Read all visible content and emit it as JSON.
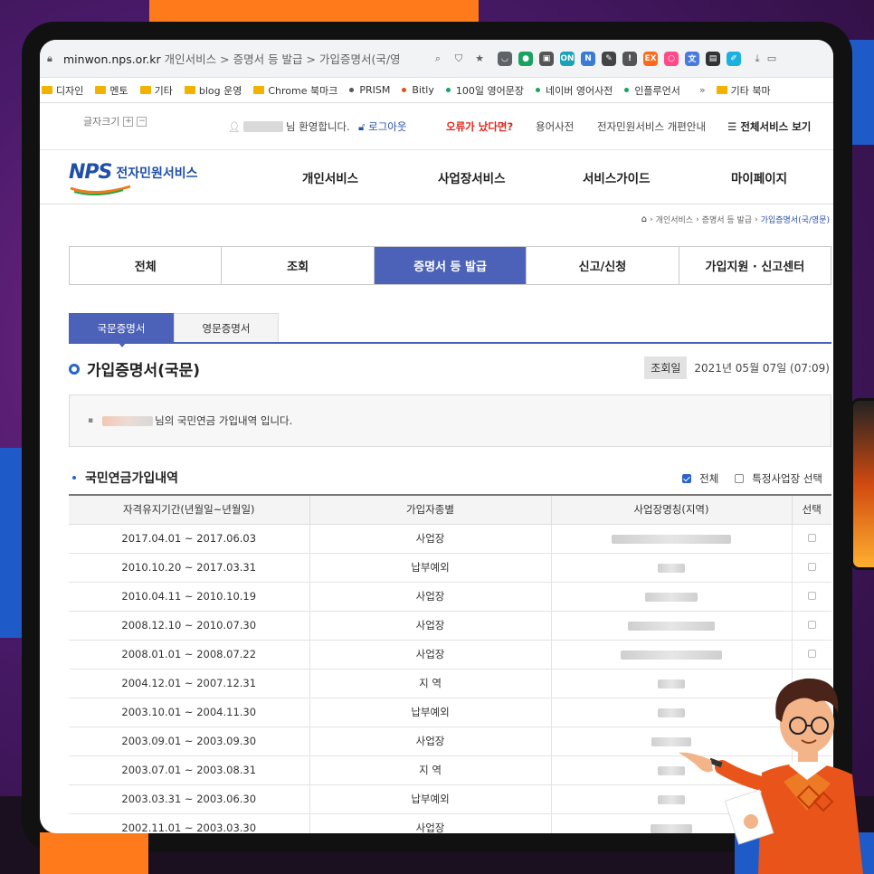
{
  "browser": {
    "url_host": "minwon.nps.or.kr",
    "url_path": "개인서비스 > 증명서 등 발급 > 가입증명서(국/영",
    "extensions": [
      {
        "name": "pocket-icon",
        "color": "#5f6368",
        "glyph": "◡"
      },
      {
        "name": "evernote-icon",
        "color": "#1aa260",
        "glyph": "●"
      },
      {
        "name": "office-icon",
        "color": "#555555",
        "glyph": "▣"
      },
      {
        "name": "onenote-icon",
        "color": "#1aa3b8",
        "glyph": "ON"
      },
      {
        "name": "new-extension-icon",
        "color": "#3a7bd5",
        "glyph": "N"
      },
      {
        "name": "pen-icon",
        "color": "#444444",
        "glyph": "✎"
      },
      {
        "name": "info-icon",
        "color": "#555555",
        "glyph": "!"
      },
      {
        "name": "ex-icon",
        "color": "#ff6a1a",
        "glyph": "EX"
      },
      {
        "name": "ring-icon",
        "color": "#ff4a8a",
        "glyph": "○"
      },
      {
        "name": "translate-icon",
        "color": "#4a7ae0",
        "glyph": "文"
      },
      {
        "name": "reader-icon",
        "color": "#333333",
        "glyph": "▤"
      },
      {
        "name": "edit-icon",
        "color": "#1ab0e0",
        "glyph": "✐"
      }
    ]
  },
  "bookmarks": {
    "items": [
      {
        "label": "디자인",
        "type": "folder"
      },
      {
        "label": "멘토",
        "type": "folder"
      },
      {
        "label": "기타",
        "type": "folder"
      },
      {
        "label": "blog 운영",
        "type": "folder"
      },
      {
        "label": "Chrome 북마크",
        "type": "folder"
      },
      {
        "label": "PRISM",
        "type": "dark"
      },
      {
        "label": "Bitly",
        "type": "red"
      },
      {
        "label": "100일 영어문장",
        "type": "green"
      },
      {
        "label": "네이버 영어사전",
        "type": "green"
      },
      {
        "label": "인플루언서",
        "type": "green"
      }
    ],
    "more": "»",
    "other": "기타 북마"
  },
  "utility": {
    "font_size_label": "글자크기",
    "font_plus": "+",
    "font_minus": "−",
    "welcome": "님 환영합니다.",
    "logout": "로그아웃",
    "error": "오류가 났다면?",
    "dictionary": "용어사전",
    "notice": "전자민원서비스 개편안내",
    "all_services": "전체서비스 보기"
  },
  "gnb": {
    "logo_text": "NPS",
    "logo_sub": "전자민원서비스",
    "items": [
      "개인서비스",
      "사업장서비스",
      "서비스가이드",
      "마이페이지"
    ]
  },
  "breadcrumb": {
    "items": [
      "개인서비스",
      "증명서 등 발급",
      "가입증명서(국/영문)"
    ]
  },
  "tabs": [
    "전체",
    "조회",
    "증명서 등 발급",
    "신고/신청",
    "가입지원 · 신고센터"
  ],
  "subtabs": [
    "국문증명서",
    "영문증명서"
  ],
  "page": {
    "title": "가입증명서(국문)",
    "query_label": "조회일",
    "query_date": "2021년 05월 07일 (07:09)",
    "info_text": "님의 국민연금 가입내역 입니다."
  },
  "section": {
    "title": "국민연금가입내역",
    "filter_all": "전체",
    "filter_specific": "특정사업장 선택"
  },
  "table": {
    "headers": [
      "자격유지기간(년월일~년월일)",
      "가입자종별",
      "사업장명칭(지역)",
      "선택"
    ],
    "rows": [
      {
        "period": "2017.04.01 ~ 2017.06.03",
        "type": "사업장"
      },
      {
        "period": "2010.10.20 ~ 2017.03.31",
        "type": "납부예외"
      },
      {
        "period": "2010.04.11 ~ 2010.10.19",
        "type": "사업장"
      },
      {
        "period": "2008.12.10 ~ 2010.07.30",
        "type": "사업장"
      },
      {
        "period": "2008.01.01 ~ 2008.07.22",
        "type": "사업장"
      },
      {
        "period": "2004.12.01 ~ 2007.12.31",
        "type": "지 역"
      },
      {
        "period": "2003.10.01 ~ 2004.11.30",
        "type": "납부예외"
      },
      {
        "period": "2003.09.01 ~ 2003.09.30",
        "type": "사업장"
      },
      {
        "period": "2003.07.01 ~ 2003.08.31",
        "type": "지 역"
      },
      {
        "period": "2003.03.31 ~ 2003.06.30",
        "type": "납부예외"
      },
      {
        "period": "2002.11.01 ~ 2003.03.30",
        "type": "사업장"
      }
    ]
  },
  "colors": {
    "accent": "#4b62b8",
    "link": "#2a4fa8",
    "error": "#e0261a",
    "frame_orange": "#ff7a1a",
    "frame_blue": "#1e5ac8"
  }
}
